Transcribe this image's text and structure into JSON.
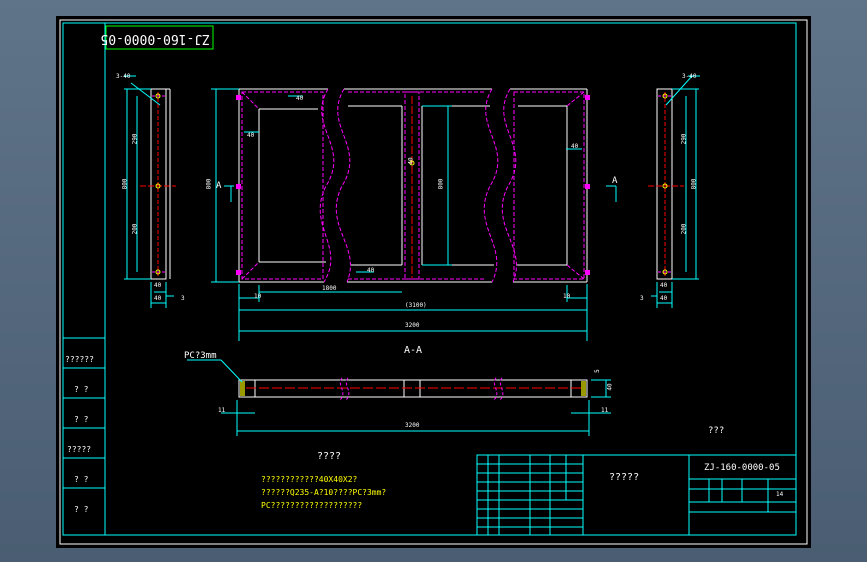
{
  "drawing_no": "ZJ-160-0000-05",
  "section": "A-A",
  "pc_note": "PC?3mm",
  "tech_title": "????",
  "tech_lines": [
    "????????????40X40X2?",
    "??????Q235-A?10????PC?3mm?",
    "PC???????????????????"
  ],
  "label_right": "???",
  "title_center": "?????",
  "title_code": "ZJ-160-0000-05",
  "title_sheet": "14",
  "section_mark": "A",
  "left_table": [
    "??????",
    "? ?",
    "? ?",
    "?????",
    "? ?",
    "? ?"
  ],
  "dims": {
    "chamfer_label": "3-40",
    "left_view": {
      "d1": "290",
      "d2": "200",
      "d3": "800",
      "d4": "40",
      "d5": "3",
      "d6": "40"
    },
    "front": {
      "h_total": "800",
      "h_inner": "800",
      "d40a": "40",
      "d40b": "40",
      "d40c": "40",
      "w_ten_l": "10",
      "w_ten_r": "10",
      "w_gap": "1800",
      "w_inner": "(3100)",
      "w_total1": "3200",
      "w_total2": "3200",
      "top40": "40",
      "bot40": "40"
    },
    "section_dims": {
      "w": "3200",
      "h": "40",
      "t1": "11",
      "t2": "11",
      "t3": "5"
    }
  },
  "colors": {
    "white": "#ffffff",
    "cyan": "#00ffff",
    "magenta": "#ff00ff",
    "red": "#ff0000",
    "yellow": "#ffff00",
    "green": "#00ff00"
  }
}
